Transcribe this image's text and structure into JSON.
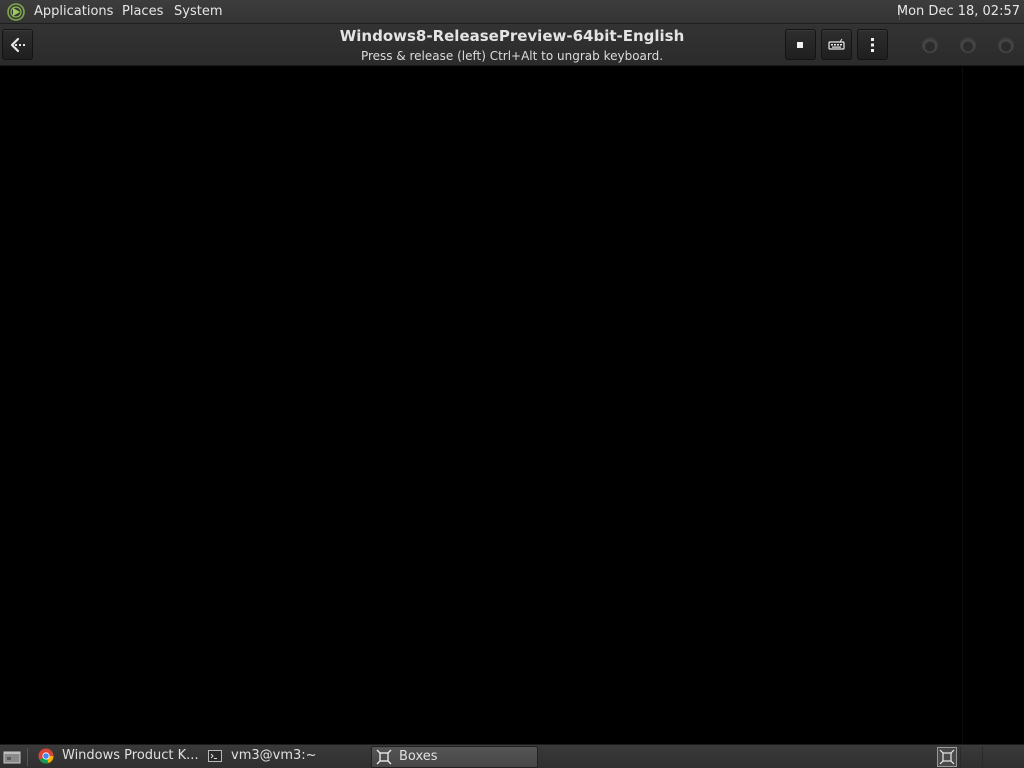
{
  "top_panel": {
    "menus": {
      "applications": "Applications",
      "places": "Places",
      "system": "System"
    },
    "clock": "Mon Dec 18, 02:57",
    "logo_icon": "mate-logo-icon"
  },
  "header": {
    "title": "Windows8-ReleasePreview-64bit-English",
    "subtitle": "Press & release (left) Ctrl+Alt to ungrab keyboard.",
    "icons": {
      "back": "back-arrow-icon",
      "stop": "stop-icon",
      "keyboard": "keyboard-icon",
      "menu": "vertical-ellipsis-icon"
    }
  },
  "taskbar": {
    "items": [
      {
        "label": "Windows Product K...",
        "icon": "chrome-icon",
        "active": false
      },
      {
        "label": "vm3@vm3:~",
        "icon": "terminal-icon",
        "active": false
      },
      {
        "label": "Boxes",
        "icon": "boxes-icon",
        "active": true
      }
    ]
  },
  "colors": {
    "panel": "#383838",
    "header": "#2f2f2f",
    "vm_background": "#000000",
    "text": "#e6e6e6"
  }
}
